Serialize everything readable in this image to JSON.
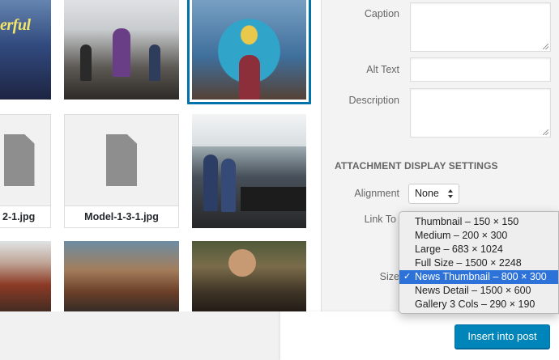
{
  "grid": {
    "tiles": [
      {
        "kind": "photo",
        "subject": "dancer",
        "overlay_text": "erful"
      },
      {
        "kind": "photo",
        "subject": "stage"
      },
      {
        "kind": "photo",
        "subject": "peacock-costume",
        "selected": true
      },
      {
        "kind": "file",
        "filename": "2-1.jpg",
        "icon": "document-icon"
      },
      {
        "kind": "file",
        "filename": "Model-1-3-1.jpg",
        "icon": "document-icon"
      },
      {
        "kind": "photo",
        "subject": "market-stall"
      },
      {
        "kind": "photo",
        "subject": "warrior"
      },
      {
        "kind": "photo",
        "subject": "puppets"
      },
      {
        "kind": "photo",
        "subject": "band"
      }
    ]
  },
  "sidebar": {
    "caption_label": "Caption",
    "alt_text_label": "Alt Text",
    "description_label": "Description",
    "section_heading": "Attachment Display Settings",
    "alignment_label": "Alignment",
    "alignment_value": "None",
    "link_to_label": "Link To",
    "size_label": "Size"
  },
  "size_menu": {
    "options": [
      "Thumbnail – 150 × 150",
      "Medium – 200 × 300",
      "Large – 683 × 1024",
      "Full Size – 1500 × 2248",
      "News Thumbnail – 800 × 300",
      "News Detail – 1500 × 600",
      "Gallery 3 Cols – 290 × 190"
    ],
    "selected_index": 4
  },
  "toolbar": {
    "insert_label": "Insert into post"
  },
  "colors": {
    "accent": "#0073aa",
    "primary_button": "#0085ba",
    "menu_highlight": "#2d72d9"
  }
}
